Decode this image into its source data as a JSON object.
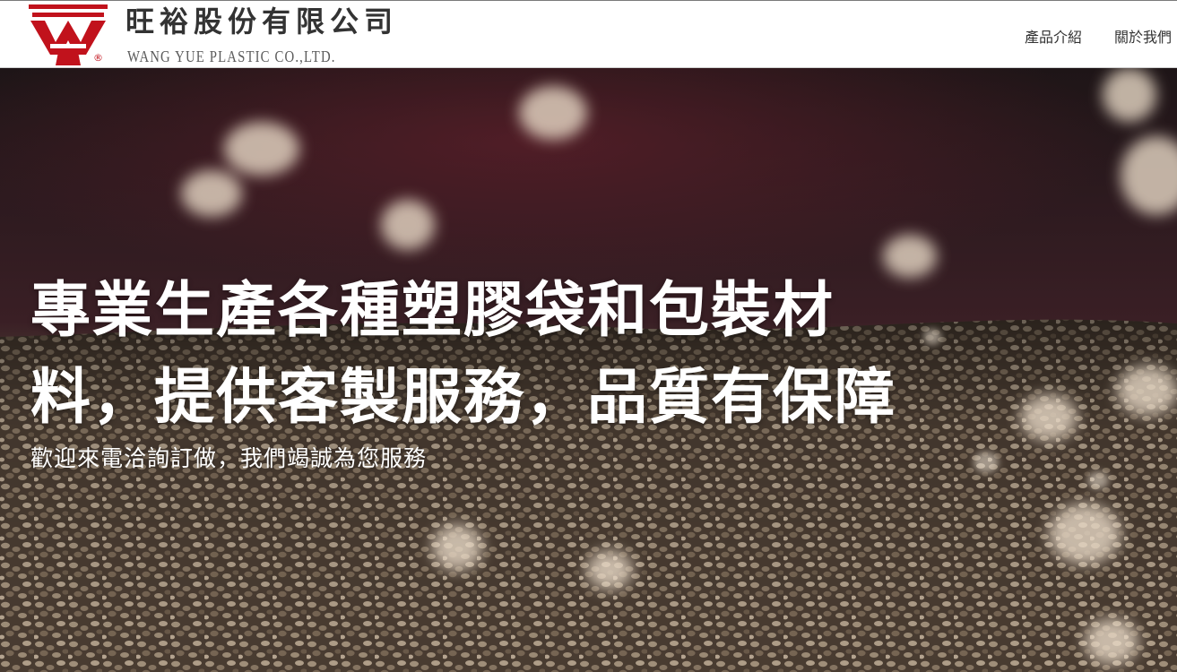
{
  "header": {
    "company_name_cn": "旺裕股份有限公司",
    "company_name_en": "WANG YUE PLASTIC CO.,LTD.",
    "registered_mark": "®",
    "logo_color": "#c1121c",
    "nav": [
      {
        "label": "產品介紹"
      },
      {
        "label": "關於我們"
      }
    ]
  },
  "hero": {
    "title_line1": "專業生產各種塑膠袋和包裝材",
    "title_line2": "料，提供客製服務，品質有保障",
    "subtitle": "歡迎來電洽詢訂做，我們竭誠為您服務",
    "background_description_icon": "plastic-pellets-background",
    "text_color": "#ffffff"
  }
}
